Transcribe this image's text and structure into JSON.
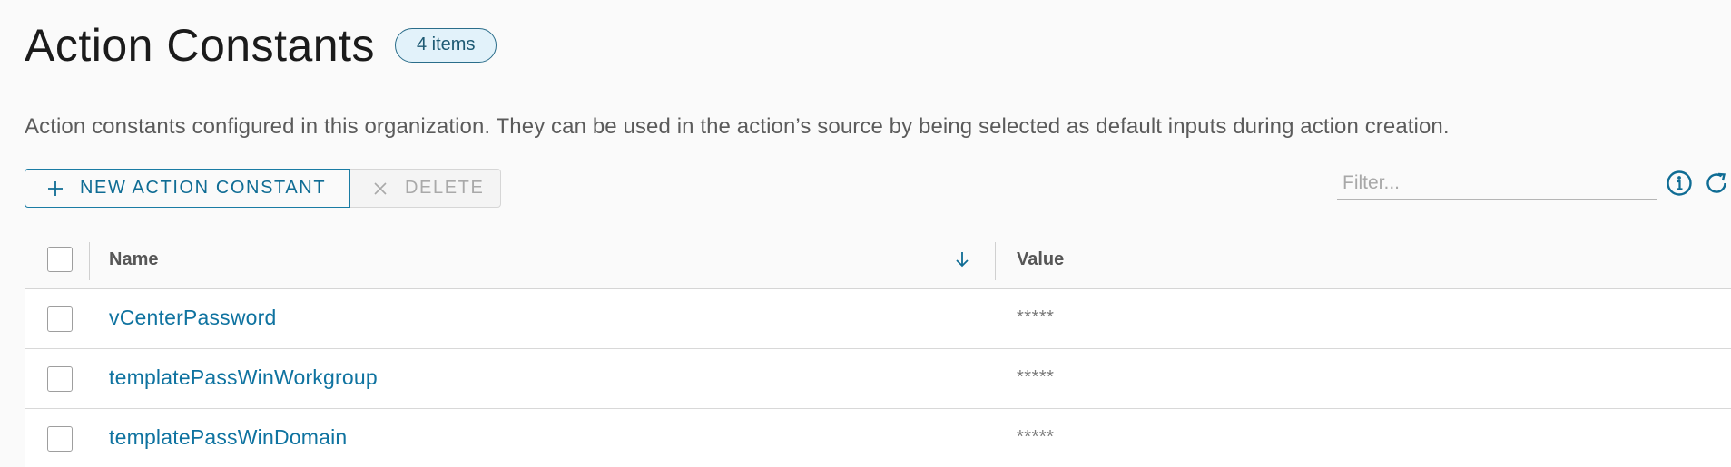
{
  "header": {
    "title": "Action Constants",
    "count_badge": "4 items"
  },
  "description": "Action constants configured in this organization. They can be used in the action’s source by being selected as default inputs during action creation.",
  "toolbar": {
    "new_label": "NEW ACTION CONSTANT",
    "delete_label": "DELETE",
    "filter_placeholder": "Filter...",
    "accent_color": "#0f6c94"
  },
  "icons": {
    "new": "plus-icon",
    "delete": "close-icon",
    "info": "info-icon",
    "refresh": "refresh-icon",
    "sort": "arrow-down-icon"
  },
  "grid": {
    "columns": {
      "name": "Name",
      "value": "Value"
    },
    "sort_direction": "descending",
    "rows": [
      {
        "name": "vCenterPassword",
        "value": "*****"
      },
      {
        "name": "templatePassWinWorkgroup",
        "value": "*****"
      },
      {
        "name": "templatePassWinDomain",
        "value": "*****"
      }
    ]
  }
}
